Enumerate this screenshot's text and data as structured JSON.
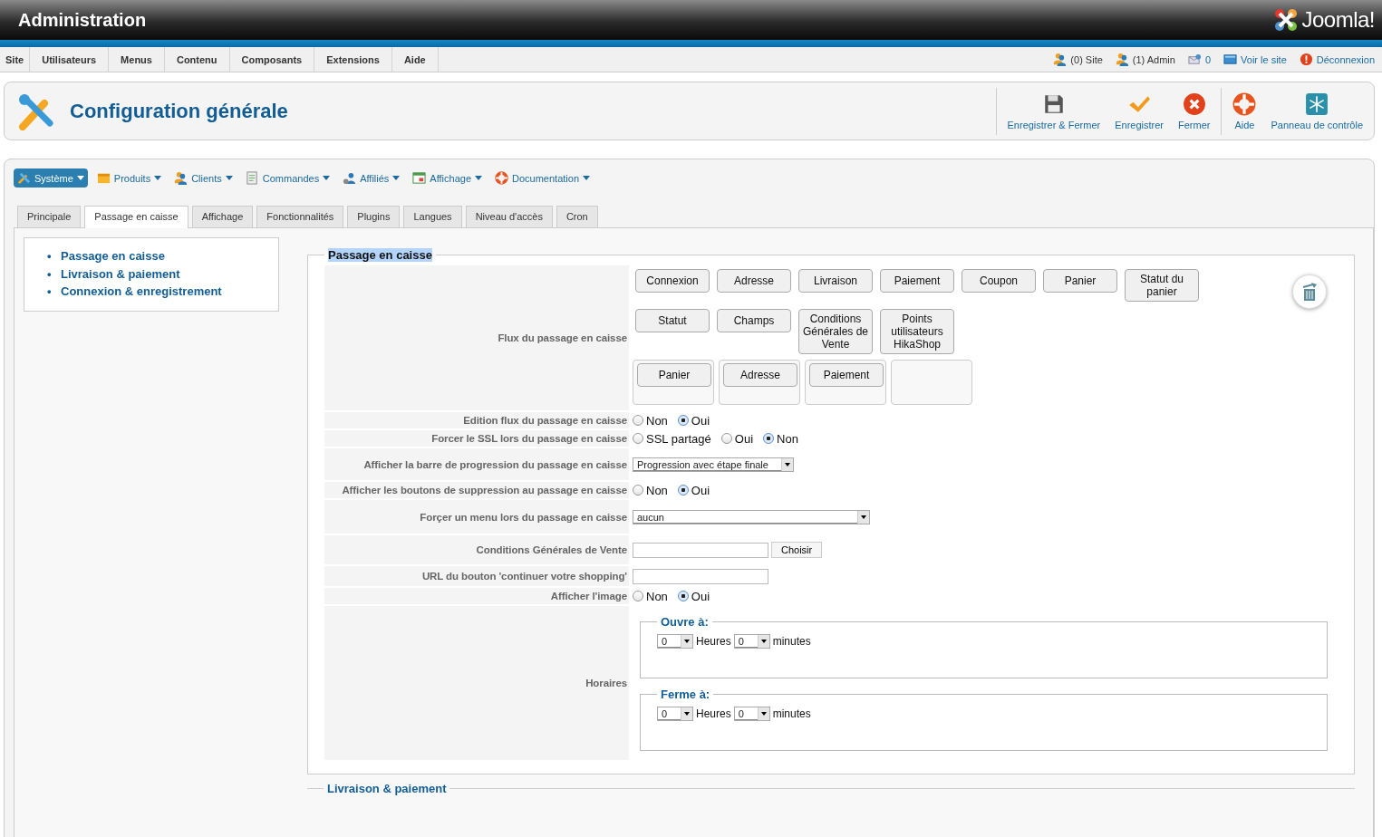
{
  "header": {
    "title": "Administration",
    "logo_text": "Joomla!"
  },
  "menu": [
    "Site",
    "Utilisateurs",
    "Menus",
    "Contenu",
    "Composants",
    "Extensions",
    "Aide"
  ],
  "status_links": [
    {
      "label": "(0) Site",
      "kind": "users"
    },
    {
      "label": "(1) Admin",
      "kind": "users"
    },
    {
      "label": "0",
      "kind": "messages"
    },
    {
      "label": "Voir le site",
      "kind": "site"
    },
    {
      "label": "Déconnexion",
      "kind": "logout"
    }
  ],
  "page_title": "Configuration générale",
  "toolbar": [
    {
      "label": "Enregistrer & Fermer",
      "kind": "save"
    },
    {
      "label": "Enregistrer",
      "kind": "apply"
    },
    {
      "label": "Fermer",
      "kind": "close"
    },
    {
      "label": "Aide",
      "kind": "help"
    },
    {
      "label": "Panneau de contrôle",
      "kind": "panel"
    }
  ],
  "component_menu": [
    {
      "label": "Système",
      "kind": "system",
      "selected": true
    },
    {
      "label": "Produits",
      "kind": "products",
      "selected": false
    },
    {
      "label": "Clients",
      "kind": "users",
      "selected": false
    },
    {
      "label": "Commandes",
      "kind": "orders",
      "selected": false
    },
    {
      "label": "Affiliés",
      "kind": "affiliates",
      "selected": false
    },
    {
      "label": "Affichage",
      "kind": "display",
      "selected": false
    },
    {
      "label": "Documentation",
      "kind": "help",
      "selected": false
    }
  ],
  "tabs": [
    {
      "label": "Principale",
      "selected": false
    },
    {
      "label": "Passage en caisse",
      "selected": true
    },
    {
      "label": "Affichage",
      "selected": false
    },
    {
      "label": "Fonctionnalités",
      "selected": false
    },
    {
      "label": "Plugins",
      "selected": false
    },
    {
      "label": "Langues",
      "selected": false
    },
    {
      "label": "Niveau d'accès",
      "selected": false
    },
    {
      "label": "Cron",
      "selected": false
    }
  ],
  "sidebar_links": [
    {
      "bullet": "•",
      "label": "Passage en caisse"
    },
    {
      "bullet": "•",
      "label": "Livraison & paiement"
    },
    {
      "bullet": "•",
      "label": "Connexion & enregistrement"
    }
  ],
  "section": {
    "legend": "Passage en caisse",
    "highlighted": true,
    "flow": {
      "label": "Flux du passage en caisse",
      "available": [
        [
          "Connexion",
          "Adresse",
          "Livraison",
          "Paiement",
          "Coupon",
          "Panier",
          "Statut du panier"
        ],
        [
          "Statut",
          "Champs",
          "Conditions Générales de Vente",
          "Points utilisateurs HikaShop"
        ]
      ],
      "steps": [
        {
          "kind": "filled",
          "buttons": [
            "Panier"
          ]
        },
        {
          "kind": "filled",
          "buttons": [
            "Adresse"
          ]
        },
        {
          "kind": "filled",
          "buttons": [
            "Paiement"
          ]
        },
        {
          "kind": "empty"
        }
      ]
    },
    "rows": [
      {
        "label": "Edition flux du passage en caisse",
        "kind": "radio",
        "options": [
          {
            "label": "Non",
            "selected": false
          },
          {
            "label": "Oui",
            "selected": true
          }
        ]
      },
      {
        "label": "Forcer le SSL lors du passage en caisse",
        "kind": "radio",
        "options": [
          {
            "label": "SSL partagé",
            "selected": false
          },
          {
            "label": "Oui",
            "selected": false
          },
          {
            "label": "Non",
            "selected": true
          }
        ]
      },
      {
        "label": "Afficher la barre de progression du passage en caisse",
        "kind": "select",
        "value": "Progression avec étape finale"
      },
      {
        "label": "Afficher les boutons de suppression au passage en caisse",
        "kind": "radio",
        "options": [
          {
            "label": "Non",
            "selected": false
          },
          {
            "label": "Oui",
            "selected": true
          }
        ]
      },
      {
        "label": "Forçer un menu lors du passage en caisse",
        "kind": "select_wide",
        "value": "aucun"
      },
      {
        "label": "Conditions Générales de Vente",
        "kind": "text_button",
        "button": "Choisir"
      },
      {
        "label": "URL du bouton 'continuer votre shopping'",
        "kind": "text"
      },
      {
        "label": "Afficher l'image",
        "kind": "radio",
        "options": [
          {
            "label": "Non",
            "selected": false
          },
          {
            "label": "Oui",
            "selected": true
          }
        ]
      }
    ],
    "hours": {
      "label": "Horaires",
      "groups": [
        {
          "legend": "Ouvre à:",
          "hours": "0",
          "hours_label": "Heures",
          "minutes": "0",
          "minutes_label": "minutes"
        },
        {
          "legend": "Ferme à:",
          "hours": "0",
          "hours_label": "Heures",
          "minutes": "0",
          "minutes_label": "minutes"
        }
      ]
    }
  },
  "next_section": {
    "legend": "Livraison & paiement"
  }
}
